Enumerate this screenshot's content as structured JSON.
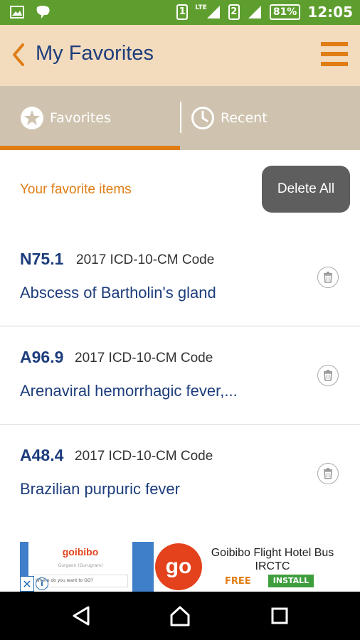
{
  "status_bar": {
    "lte": "LTE",
    "sim1": "1",
    "sim2": "2",
    "battery": "81%",
    "time": "12:05"
  },
  "header": {
    "title": "My Favorites"
  },
  "tabs": [
    {
      "label": "Favorites",
      "icon": "star-icon",
      "active": true
    },
    {
      "label": "Recent",
      "icon": "clock-icon",
      "active": false
    }
  ],
  "list": {
    "section_label": "Your favorite items",
    "delete_all_label": "Delete All",
    "items": [
      {
        "code": "N75.1",
        "type": "2017 ICD-10-CM Code",
        "description": "Abscess of Bartholin's gland"
      },
      {
        "code": "A96.9",
        "type": "2017 ICD-10-CM Code",
        "description": "Arenaviral hemorrhagic fever,..."
      },
      {
        "code": "A48.4",
        "type": "2017 ICD-10-CM Code",
        "description": "Brazilian purpuric fever"
      }
    ]
  },
  "ad": {
    "brand": "goibibo",
    "sub": "Gurgaon (Gurugram)",
    "field": "Where do you want to GO?",
    "logo": "go",
    "title": "Goibibo Flight Hotel Bus IRCTC",
    "free": "FREE",
    "install": "INSTALL",
    "close": "✕",
    "info": "i"
  },
  "colors": {
    "status_bar": "#5e9e2e",
    "header_bg": "#f3dbbd",
    "tab_bg": "#cfc3af",
    "accent": "#e07d14",
    "navy": "#1d3d7c"
  }
}
